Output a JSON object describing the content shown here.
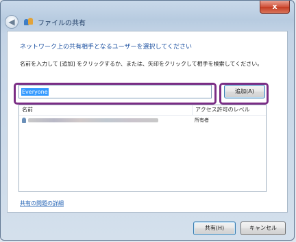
{
  "window": {
    "title": "ファイルの共有",
    "close_label": "x"
  },
  "content": {
    "heading": "ネットワーク上の共有相手となるユーザーを選択してください",
    "instruction": "名前を入力して [追加] をクリックするか、または、矢印をクリックして相手を検索してください。",
    "name_input_value": "Everyone",
    "add_button": "追加(A)",
    "list": {
      "headers": [
        "名前",
        "アクセス許可のレベル"
      ],
      "rows": [
        {
          "name": "",
          "access": "所有者"
        }
      ]
    },
    "problems_link": "共有の問題の詳細"
  },
  "footer": {
    "share_button": "共有(H)",
    "cancel_button": "キャンセル"
  },
  "colors": {
    "highlight_border": "#7b2d85",
    "link": "#1e5fb3",
    "heading": "#1a4fa0"
  }
}
